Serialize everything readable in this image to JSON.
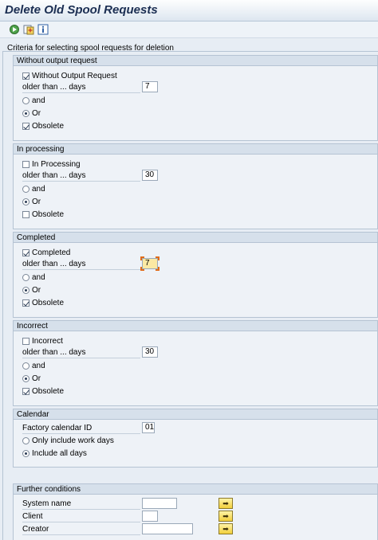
{
  "window": {
    "title": "Delete Old Spool Requests"
  },
  "toolbar": {
    "icons": [
      "execute-icon",
      "variant-icon",
      "info-icon"
    ]
  },
  "criteria_title": "Criteria for selecting spool requests for deletion",
  "groups": {
    "without_output": {
      "header": "Without output request",
      "checkbox_label": "Without Output Request",
      "checkbox_checked": true,
      "days_label": "older than ... days",
      "days_value": "7",
      "and_label": "and",
      "or_label": "Or",
      "selected": "or",
      "obsolete_label": "Obsolete",
      "obsolete_checked": true
    },
    "in_processing": {
      "header": "In processing",
      "checkbox_label": "In Processing",
      "checkbox_checked": false,
      "days_label": "older than ... days",
      "days_value": "30",
      "and_label": "and",
      "or_label": "Or",
      "selected": "or",
      "obsolete_label": "Obsolete",
      "obsolete_checked": false
    },
    "completed": {
      "header": "Completed",
      "checkbox_label": "Completed",
      "checkbox_checked": true,
      "days_label": "older than ... days",
      "days_value": "7",
      "and_label": "and",
      "or_label": "Or",
      "selected": "or",
      "obsolete_label": "Obsolete",
      "obsolete_checked": true
    },
    "incorrect": {
      "header": "Incorrect",
      "checkbox_label": "Incorrect",
      "checkbox_checked": false,
      "days_label": "older than ... days",
      "days_value": "30",
      "and_label": "and",
      "or_label": "Or",
      "selected": "or",
      "obsolete_label": "Obsolete",
      "obsolete_checked": true
    },
    "calendar": {
      "header": "Calendar",
      "factory_label": "Factory calendar ID",
      "factory_value": "01",
      "only_work_label": "Only include work days",
      "include_all_label": "Include all days",
      "selected": "include_all"
    },
    "further": {
      "header": "Further conditions",
      "system_label": "System name",
      "client_label": "Client",
      "creator_label": "Creator",
      "system_value": "",
      "client_value": "",
      "creator_value": ""
    }
  },
  "colors": {
    "title": "#1b2e52",
    "group_header": "#d6e0eb",
    "focus_field": "#fbe9a3"
  }
}
